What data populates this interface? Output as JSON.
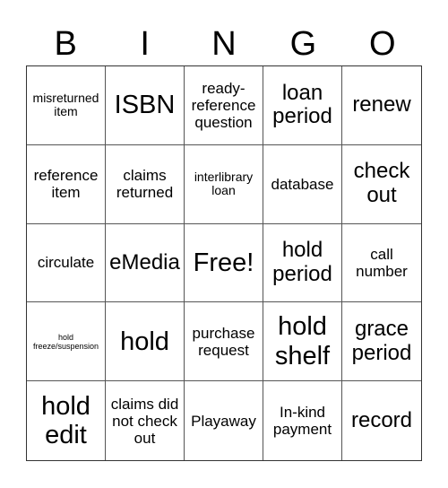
{
  "header": [
    "B",
    "I",
    "N",
    "G",
    "O"
  ],
  "cells": [
    {
      "text": "misreturned item",
      "size": "s-sm"
    },
    {
      "text": "ISBN",
      "size": "s-xl"
    },
    {
      "text": "ready-reference question",
      "size": "s-md"
    },
    {
      "text": "loan period",
      "size": "s-lg"
    },
    {
      "text": "renew",
      "size": "s-lg"
    },
    {
      "text": "reference item",
      "size": "s-md"
    },
    {
      "text": "claims returned",
      "size": "s-md"
    },
    {
      "text": "interlibrary loan",
      "size": "s-sm"
    },
    {
      "text": "database",
      "size": "s-md"
    },
    {
      "text": "check out",
      "size": "s-lg"
    },
    {
      "text": "circulate",
      "size": "s-md"
    },
    {
      "text": "eMedia",
      "size": "s-lg"
    },
    {
      "text": "Free!",
      "size": "s-xl"
    },
    {
      "text": "hold period",
      "size": "s-lg"
    },
    {
      "text": "call number",
      "size": "s-md"
    },
    {
      "text": "hold freeze/suspension",
      "size": "s-xs"
    },
    {
      "text": "hold",
      "size": "s-xl"
    },
    {
      "text": "purchase request",
      "size": "s-md"
    },
    {
      "text": "hold shelf",
      "size": "s-xl"
    },
    {
      "text": "grace period",
      "size": "s-lg"
    },
    {
      "text": "hold edit",
      "size": "s-xl"
    },
    {
      "text": "claims did not check out",
      "size": "s-md"
    },
    {
      "text": "Playaway",
      "size": "s-md"
    },
    {
      "text": "In-kind payment",
      "size": "s-md"
    },
    {
      "text": "record",
      "size": "s-lg"
    }
  ]
}
